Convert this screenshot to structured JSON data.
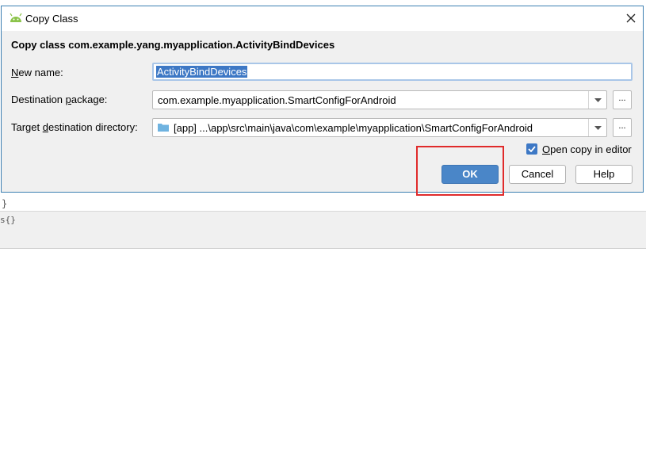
{
  "background": {
    "brace": "}",
    "bar_text": "s{}"
  },
  "dialog": {
    "title": "Copy Class",
    "header": "Copy class com.example.yang.myapplication.ActivityBindDevices",
    "new_name": {
      "label_prefix": "",
      "label_mnemonic": "N",
      "label_rest": "ew name:",
      "value": "ActivityBindDevices"
    },
    "destination_package": {
      "label_prefix": "Destination ",
      "label_mnemonic": "p",
      "label_rest": "ackage:",
      "value": "com.example.myapplication.SmartConfigForAndroid",
      "browse_label": "..."
    },
    "target_directory": {
      "label_prefix": "Target ",
      "label_mnemonic": "d",
      "label_rest": "estination directory:",
      "value": "[app] ...\\app\\src\\main\\java\\com\\example\\myapplication\\SmartConfigForAndroid",
      "browse_label": "..."
    },
    "open_copy": {
      "mnemonic": "O",
      "rest": "pen copy in editor",
      "checked": true
    },
    "buttons": {
      "ok": "OK",
      "cancel": "Cancel",
      "help": "Help"
    }
  },
  "colors": {
    "accent": "#4a86c8",
    "highlight": "#e02b2b",
    "android_green": "#8bc34a",
    "folder": "#6fb3e0"
  },
  "icons": {
    "title": "android-icon",
    "close": "close-icon",
    "dropdown": "chevron-down-icon",
    "folder": "folder-icon",
    "check": "checkmark-icon"
  }
}
